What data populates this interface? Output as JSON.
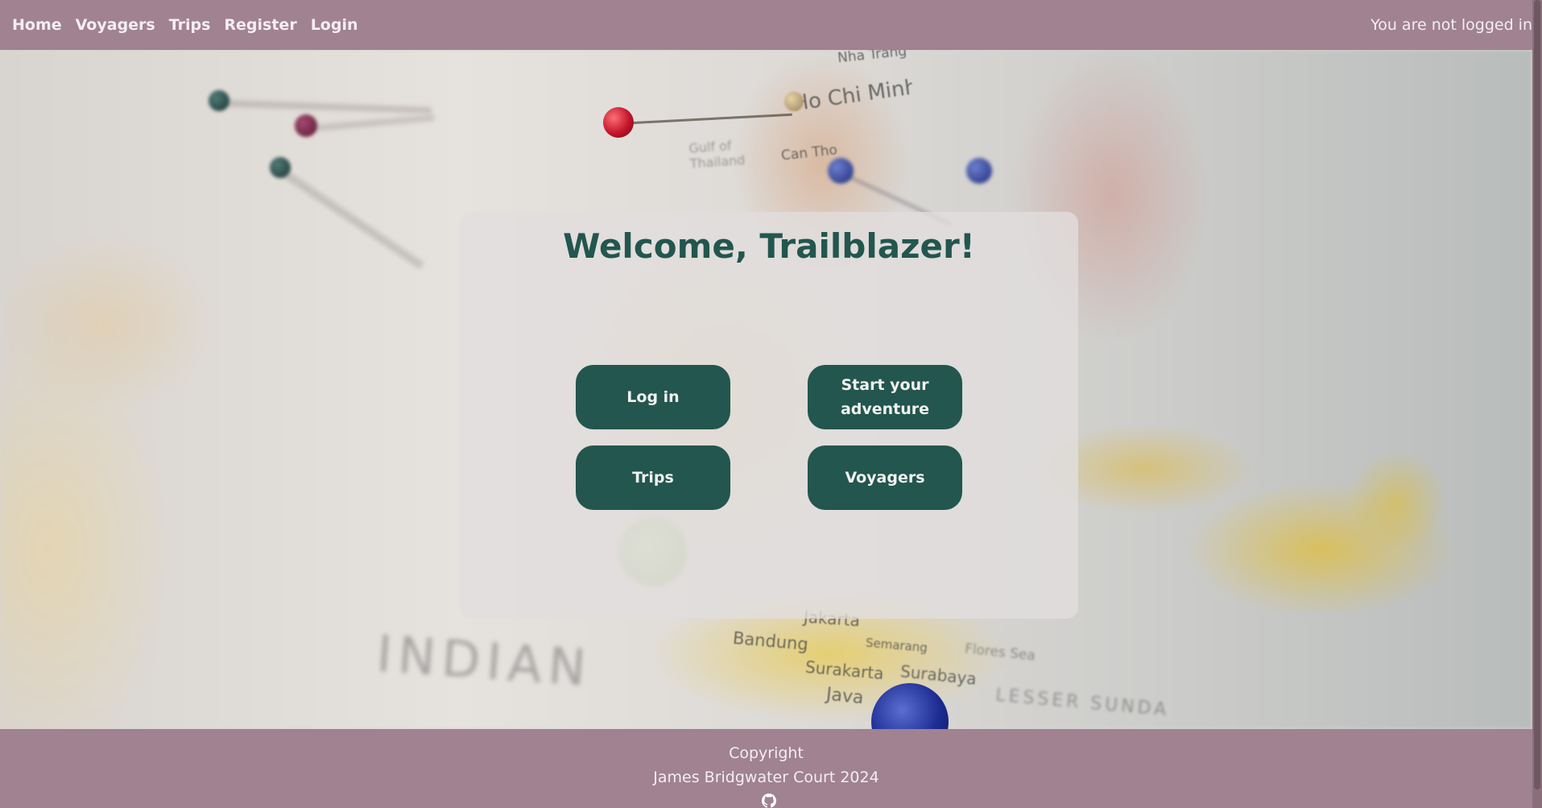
{
  "navbar": {
    "links": [
      "Home",
      "Voyagers",
      "Trips",
      "Register",
      "Login"
    ],
    "status": "You are not logged in"
  },
  "hero": {
    "map_labels": {
      "ho_chi_minh": "Ho Chi Minh City",
      "can_tho": "Can Tho",
      "gulf": "Gulf of Thailand",
      "nha_trang": "Nha Trang",
      "jakarta": "Jakarta",
      "bandung": "Bandung",
      "semarang": "Semarang",
      "surakarta": "Surakarta",
      "surabaya": "Surabaya",
      "java": "Java",
      "indian": "INDIAN",
      "flores": "Flores Sea",
      "lesser_sunda": "LESSER SUNDA"
    }
  },
  "card": {
    "title": "Welcome, Trailblazer!",
    "buttons": {
      "login": "Log in",
      "start": "Start your adventure",
      "trips": "Trips",
      "voyagers": "Voyagers"
    }
  },
  "footer": {
    "line1": "Copyright",
    "line2": "James Bridgwater Court 2024",
    "icon": "github-icon"
  },
  "colors": {
    "bar": "#a08290",
    "accent": "#22564e",
    "card": "#e1dede"
  }
}
